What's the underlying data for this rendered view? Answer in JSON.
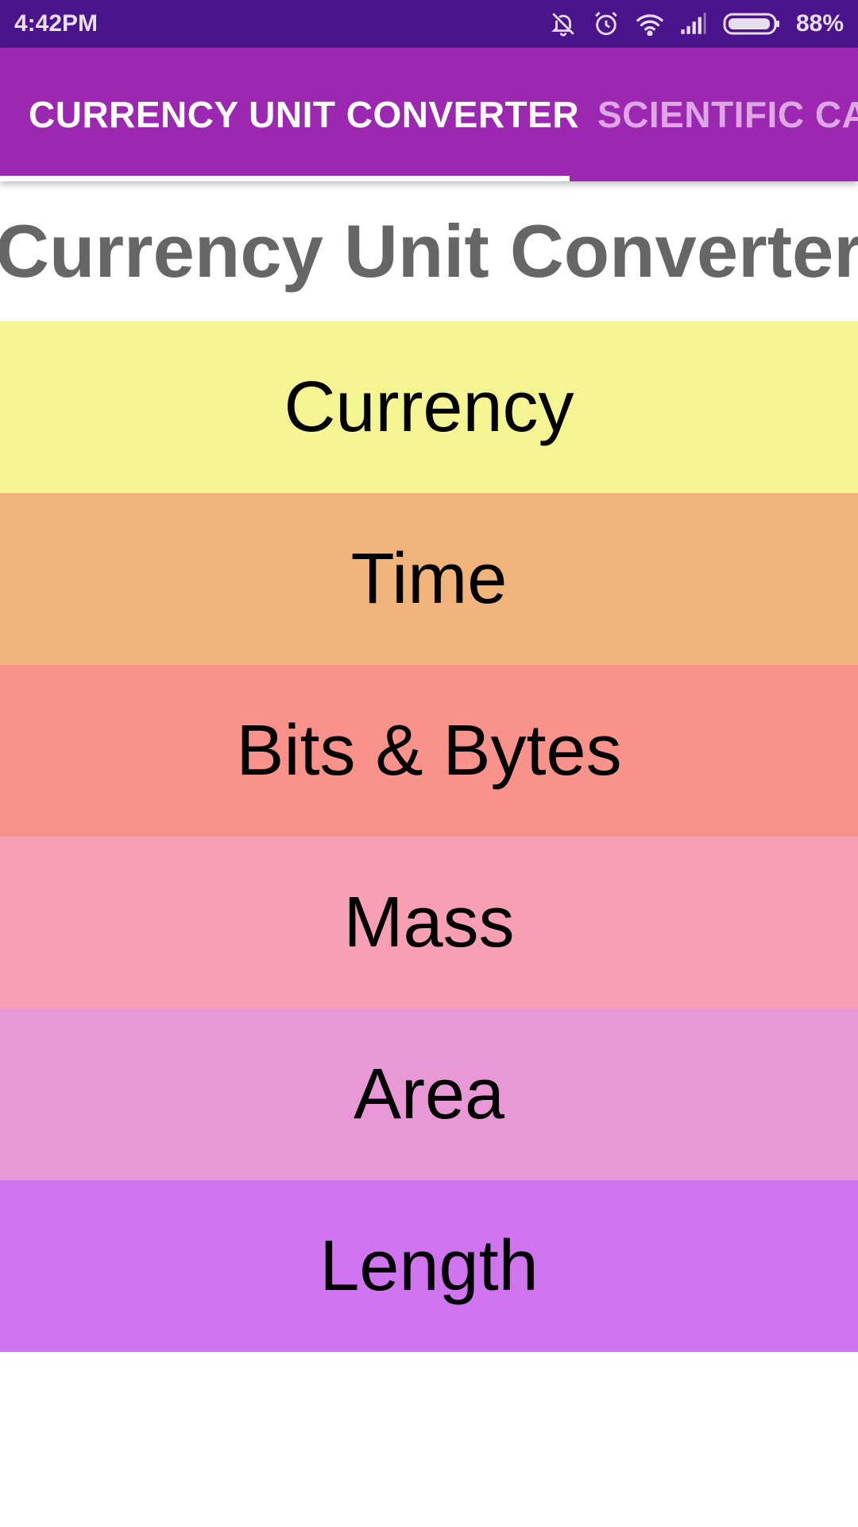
{
  "status_bar": {
    "time": "4:42PM",
    "battery_percent": "88%",
    "icons": [
      "notifications-off-icon",
      "alarm-icon",
      "wifi-icon",
      "cellular-signal-icon",
      "battery-icon"
    ]
  },
  "tabs": [
    {
      "label": "CURRENCY UNIT CONVERTER",
      "active": true
    },
    {
      "label": "SCIENTIFIC CA",
      "active": false
    }
  ],
  "page_title": "Currency Unit Converter",
  "categories": [
    {
      "label": "Currency",
      "color": "#f4f492"
    },
    {
      "label": "Time",
      "color": "#f0b37a"
    },
    {
      "label": "Bits & Bytes",
      "color": "#f9928a"
    },
    {
      "label": "Mass",
      "color": "#f8a0b3"
    },
    {
      "label": "Area",
      "color": "#e898d6"
    },
    {
      "label": "Length",
      "color": "#d074f0"
    }
  ],
  "colors": {
    "status_bar": "#4a148c",
    "tab_bar": "#9c27b0",
    "title_text": "#666666"
  }
}
